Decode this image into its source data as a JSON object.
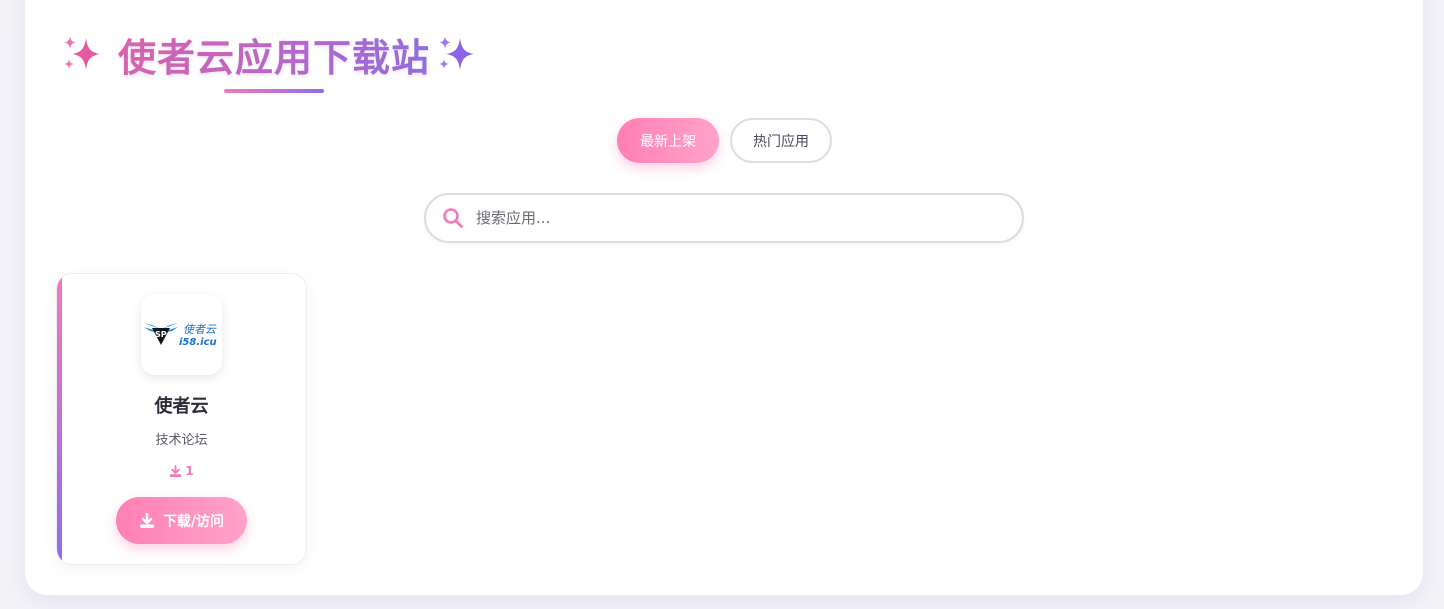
{
  "header": {
    "title": "使者云应用下载站",
    "icon_left": "sparkles-icon",
    "icon_right": "sparkles-icon"
  },
  "tabs": [
    {
      "label": "最新上架",
      "active": true
    },
    {
      "label": "热门应用",
      "active": false
    }
  ],
  "search": {
    "placeholder": "搜索应用...",
    "value": "",
    "icon": "search-icon"
  },
  "apps": [
    {
      "name": "使者云",
      "description": "技术论坛",
      "downloads": "1",
      "button_label": "下载/访问",
      "logo_text": "使者云",
      "logo_domain": "i58.icu"
    }
  ],
  "colors": {
    "accent_pink": "#ff7fb5",
    "accent_purple": "#8d6cf0",
    "title_gradient_start": "#e063a8",
    "title_gradient_end": "#8f6ee3"
  }
}
